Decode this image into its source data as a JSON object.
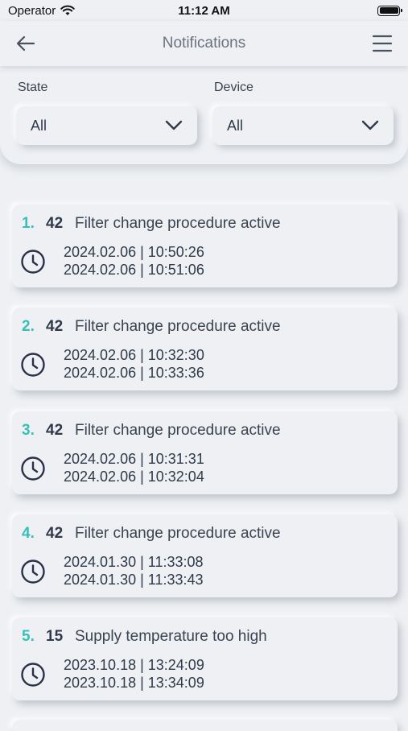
{
  "status_bar": {
    "carrier": "Operator",
    "time": "11:12 AM",
    "battery_level": 1.0
  },
  "nav": {
    "title": "Notifications",
    "back_icon": "arrow-left-icon",
    "menu_icon": "hamburger-menu-icon"
  },
  "filters": {
    "state": {
      "label": "State",
      "value": "All"
    },
    "device": {
      "label": "Device",
      "value": "All"
    }
  },
  "notifications": [
    {
      "index": "1.",
      "code": "42",
      "message": "Filter change procedure active",
      "start": "2024.02.06 | 10:50:26",
      "end": "2024.02.06 | 10:51:06"
    },
    {
      "index": "2.",
      "code": "42",
      "message": "Filter change procedure active",
      "start": "2024.02.06 | 10:32:30",
      "end": "2024.02.06 | 10:33:36"
    },
    {
      "index": "3.",
      "code": "42",
      "message": "Filter change procedure active",
      "start": "2024.02.06 | 10:31:31",
      "end": "2024.02.06 | 10:32:04"
    },
    {
      "index": "4.",
      "code": "42",
      "message": "Filter change procedure active",
      "start": "2024.01.30 | 11:33:08",
      "end": "2024.01.30 | 11:33:43"
    },
    {
      "index": "5.",
      "code": "15",
      "message": "Supply temperature too high",
      "start": "2023.10.18 | 13:24:09",
      "end": "2023.10.18 | 13:34:09"
    }
  ],
  "colors": {
    "background": "#eef0f3",
    "accent_index": "#36c0b8",
    "clock_icon": "#2c2f4a"
  }
}
